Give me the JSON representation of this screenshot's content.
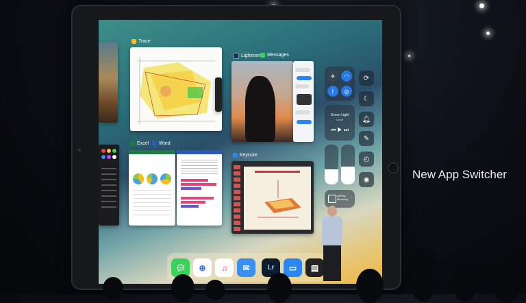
{
  "slide_title": "New App Switcher",
  "apps": {
    "trace_label": "Trace",
    "lightroom_label": "Lightroom",
    "messages_label": "Messages",
    "excel_label": "Excel",
    "word_label": "Word",
    "keynote_label": "Keynote"
  },
  "control_center": {
    "music_title": "Green Light",
    "music_artist": "Lorde",
    "airplay_label": "AirPlay Mirroring"
  },
  "dock": {
    "icons": [
      "messages-icon",
      "safari-icon",
      "music-icon",
      "mail-icon",
      "lightroom-icon",
      "keynote-icon",
      "files-icon"
    ]
  },
  "colors": {
    "accent_blue": "#2b78e4",
    "wallpaper_gold": "#f0b440",
    "wallpaper_teal": "#3d8f8a"
  }
}
